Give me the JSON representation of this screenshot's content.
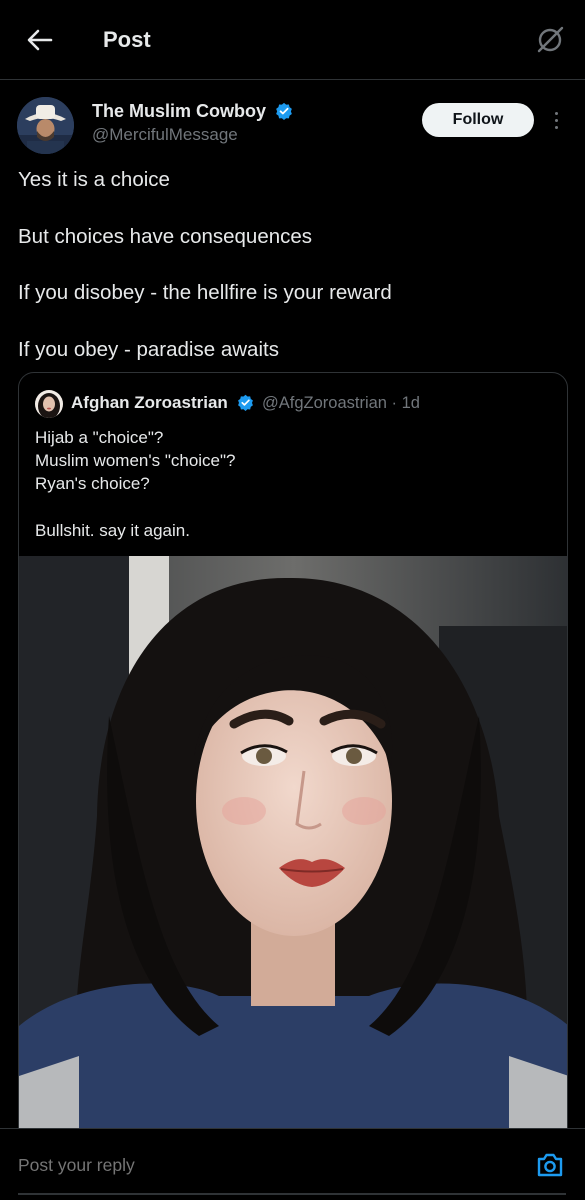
{
  "header": {
    "title": "Post",
    "back_icon": "arrow-left-icon",
    "grok_icon": "grok-icon"
  },
  "post": {
    "author_name": "The Muslim Cowboy",
    "author_handle": "@MercifulMessage",
    "verified": true,
    "follow_label": "Follow",
    "lines": [
      "Yes it is a choice",
      "But choices have consequences",
      "If you disobey - the hellfire is your reward",
      "If you obey - paradise awaits"
    ]
  },
  "quote": {
    "author_name": "Afghan Zoroastrian",
    "author_handle": "@AfgZoroastrian · 1d",
    "verified": true,
    "lines": [
      "Hijab a \"choice\"?",
      "Muslim women's \"choice\"?",
      "Ryan's choice?",
      "Bullshit. say it again."
    ]
  },
  "reply": {
    "placeholder": "Post your reply",
    "camera_icon": "camera-icon"
  },
  "colors": {
    "background": "#000000",
    "text": "#e7e9ea",
    "muted": "#71767b",
    "accent": "#1d9bf0",
    "border": "#2f3336"
  }
}
